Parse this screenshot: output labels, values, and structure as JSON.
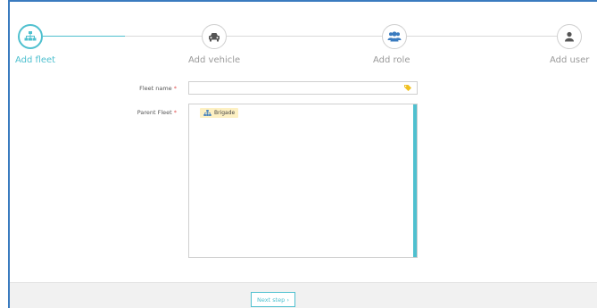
{
  "wizard": {
    "steps": [
      {
        "label": "Add fleet",
        "icon": "sitemap-icon",
        "active": true
      },
      {
        "label": "Add vehicle",
        "icon": "car-icon",
        "active": false
      },
      {
        "label": "Add role",
        "icon": "users-icon",
        "active": false
      },
      {
        "label": "Add user",
        "icon": "user-icon",
        "active": false
      }
    ]
  },
  "form": {
    "fleet_name_label": "Fleet name",
    "parent_fleet_label": "Parent Fleet",
    "required_mark": "*",
    "fleet_name_value": "",
    "tree": {
      "root": "Brigade"
    }
  },
  "footer": {
    "next_label": "Next step ›"
  },
  "colors": {
    "accent": "#4fc0cf",
    "frame": "#3a7bbf",
    "node_bg": "#fdf0c2",
    "tag": "#f0c020"
  }
}
